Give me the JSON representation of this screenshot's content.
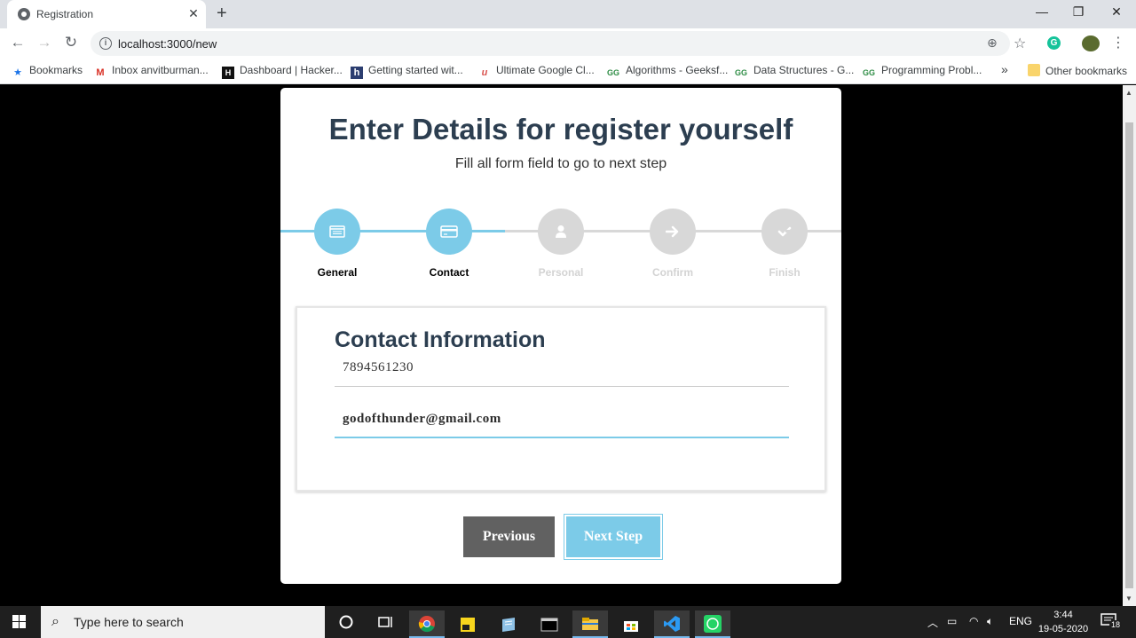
{
  "browser": {
    "tab_title": "Registration",
    "tab_close": "✕",
    "new_tab": "+",
    "url": "localhost:3000/new",
    "window_controls": {
      "minimize": "—",
      "restore": "❐",
      "close": "✕"
    },
    "bookmarks": [
      {
        "label": "Bookmarks",
        "icon": "star-icon",
        "glyph": "★"
      },
      {
        "label": "Inbox anvitburman...",
        "icon": "gmail-icon",
        "glyph": "M"
      },
      {
        "label": "Dashboard | Hacker...",
        "icon": "hackerrank-icon",
        "glyph": "H"
      },
      {
        "label": "Getting started wit...",
        "icon": "h-icon",
        "glyph": "h"
      },
      {
        "label": "Ultimate Google Cl...",
        "icon": "u-icon",
        "glyph": "u"
      },
      {
        "label": "Algorithms - Geeksf...",
        "icon": "gfg-icon",
        "glyph": "GG"
      },
      {
        "label": "Data Structures - G...",
        "icon": "gfg-icon",
        "glyph": "GG"
      },
      {
        "label": "Programming Probl...",
        "icon": "gfg-icon",
        "glyph": "GG"
      }
    ],
    "more_bookmarks": "»",
    "other_bookmarks": "Other bookmarks"
  },
  "page": {
    "title": "Enter Details for register yourself",
    "subtitle": "Fill all form field to go to next step",
    "steps": [
      {
        "label": "General",
        "active": true
      },
      {
        "label": "Contact",
        "active": true
      },
      {
        "label": "Personal",
        "active": false
      },
      {
        "label": "Confirm",
        "active": false
      },
      {
        "label": "Finish",
        "active": false
      }
    ],
    "form": {
      "heading": "Contact Information",
      "phone_value": "7894561230",
      "email_value": "godofthunder@gmail.com"
    },
    "buttons": {
      "previous": "Previous",
      "next": "Next Step"
    }
  },
  "taskbar": {
    "search_placeholder": "Type here to search",
    "language": "ENG",
    "time": "3:44",
    "date": "19-05-2020",
    "notifications": "18"
  },
  "colors": {
    "accent": "#7ccbe8",
    "inactive_step": "#d8d8d8",
    "previous_button": "#616161",
    "heading": "#2c3e50"
  }
}
